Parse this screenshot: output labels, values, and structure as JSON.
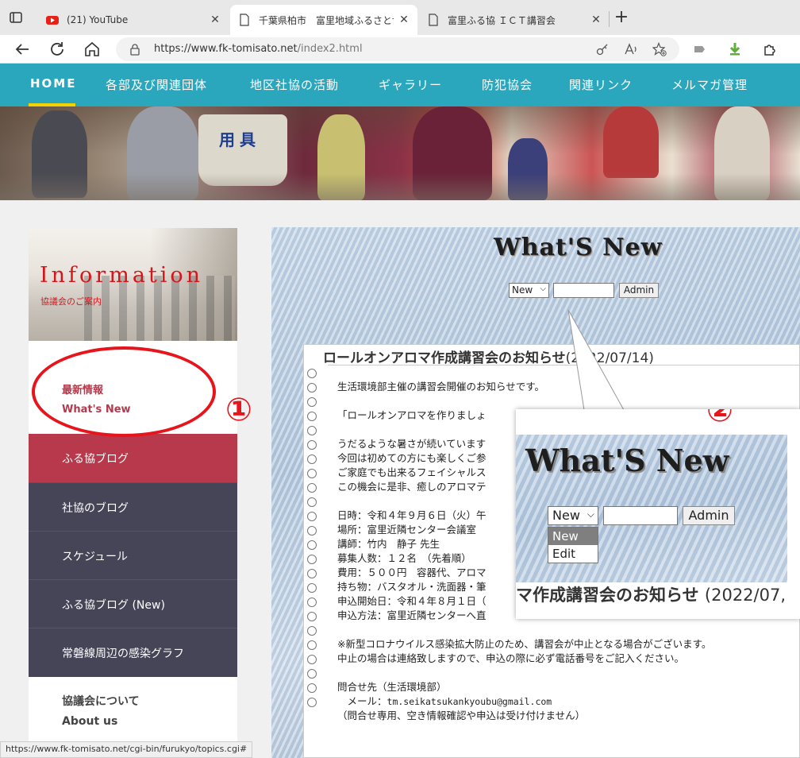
{
  "browser": {
    "tabs": [
      {
        "title": "(21) YouTube",
        "active": false
      },
      {
        "title": "千葉県柏市　富里地域ふるさと協議会",
        "active": true
      },
      {
        "title": "富里ふる協 ＩＣＴ講習会",
        "active": false
      }
    ],
    "close_glyph": "✕",
    "new_tab_glyph": "+",
    "url_host": "https://www.fk-tomisato.net",
    "url_path": "/index2.html"
  },
  "site_nav": {
    "items": [
      "HOME",
      "各部及び関連団体",
      "地区社協の活動",
      "ギャラリー",
      "防犯協会",
      "関連リンク",
      "メルマガ管理"
    ],
    "active": "HOME"
  },
  "hero": {
    "vest_text": "用具"
  },
  "sidebar": {
    "info_title": "Information",
    "info_subtitle": "協議会のご案内",
    "whats_new_jp": "最新情報",
    "whats_new_en": "What's New",
    "menu": [
      "ふる協ブログ",
      "社協のブログ",
      "スケジュール",
      "ふる協ブログ (New)",
      "常磐線周辺の感染グラフ"
    ],
    "about_jp": "協議会について",
    "about_en": "About us"
  },
  "annotations": {
    "one": "①",
    "two": "②"
  },
  "whats_new": {
    "title": "What'S New",
    "select_value": "New",
    "dropdown_arrow": "⌵",
    "admin_label": "Admin"
  },
  "notice": {
    "title": "ロールオンアロマ作成講習会のお知らせ",
    "date": "(2022/07/14)",
    "lines": [
      "生活環境部主催の講習会開催のお知らせです。",
      "",
      "「ロールオンアロマを作りましょ",
      "",
      "うだるような暑さが続いています",
      "今回は初めての方にも楽しくご参",
      "ご家庭でも出来るフェイシャルス",
      "この機会に是非、癒しのアロマテ",
      "",
      "日時：令和４年９月６日（火）午",
      "場所：富里近隣センター会議室",
      "講師：竹内　静子 先生",
      "募集人数：１２名　（先着順）",
      "費用：５００円　容器代、アロマ",
      "持ち物：バスタオル・洗面器・筆",
      "申込開始日：令和４年８月１日（",
      "申込方法：富里近隣センターへ直",
      "",
      "※新型コロナウイルス感染拡大防止のため、講習会が中止となる場合がございます。",
      "中止の場合は連絡致しますので、申込の際に必ず電話番号をご記入ください。",
      "",
      "問合せ先（生活環境部）",
      "　メール：",
      "（問合せ専用、空き情報確認や申込は受け付けません）"
    ],
    "email": "tm.seikatsukankyoubu@gmail.com"
  },
  "zoom": {
    "title": "What'S New",
    "select_value": "New",
    "admin_label": "Admin",
    "options": [
      "New",
      "Edit"
    ],
    "footer_title": "マ作成講習会のお知らせ",
    "footer_date": "(2022/07,"
  },
  "status_url": "https://www.fk-tomisato.net/cgi-bin/furukyo/topics.cgi#"
}
